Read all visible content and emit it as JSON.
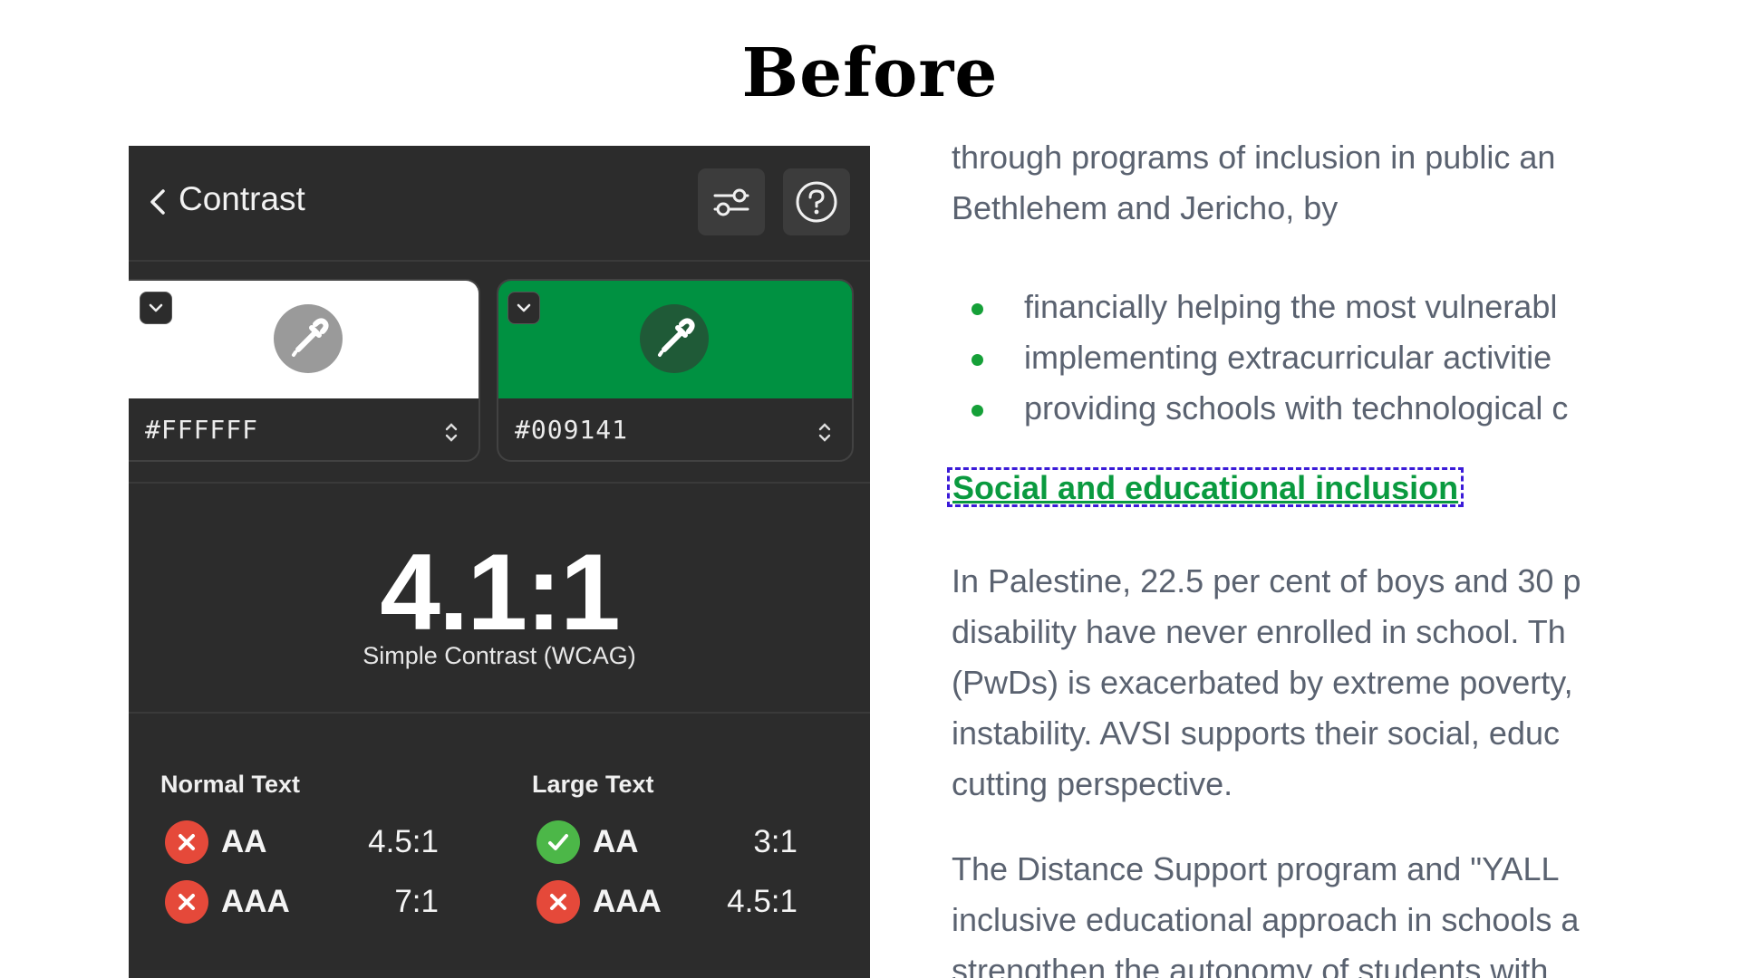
{
  "title": "Before",
  "panel": {
    "header": {
      "title": "Contrast"
    },
    "background_color": {
      "hex": "#FFFFFF"
    },
    "foreground_color": {
      "hex": "#009141"
    },
    "ratio": "4.1:1",
    "ratio_label": "Simple Contrast (WCAG)",
    "normal_text": {
      "title": "Normal Text",
      "rows": [
        {
          "level": "AA",
          "value": "4.5:1",
          "status": "fail"
        },
        {
          "level": "AAA",
          "value": "7:1",
          "status": "fail"
        }
      ]
    },
    "large_text": {
      "title": "Large Text",
      "rows": [
        {
          "level": "AA",
          "value": "3:1",
          "status": "pass"
        },
        {
          "level": "AAA",
          "value": "4.5:1",
          "status": "fail"
        }
      ]
    }
  },
  "article": {
    "intro_lines": [
      "through programs of inclusion in public an",
      "Bethlehem and Jericho, by"
    ],
    "bullets": [
      "financially helping the most vulnerabl",
      "implementing extracurricular activitie",
      "providing schools with technological c"
    ],
    "heading": "Social and educational inclusion",
    "para1_lines": [
      "In Palestine, 22.5 per cent of boys and 30 p",
      "disability have never enrolled in school. Th",
      "(PwDs) is exacerbated by extreme poverty,",
      "instability. AVSI supports their social, educ",
      "cutting perspective."
    ],
    "para2_lines": [
      "The Distance Support program and \"YALL",
      "inclusive educational approach in schools a",
      "strengthen the autonomy of students with"
    ]
  },
  "colors": {
    "panel_bg": "#2c2c2c",
    "brand_green": "#009141",
    "fail_red": "#e5493a",
    "pass_green": "#4cb748",
    "focus_outline": "#3b1bd8"
  }
}
